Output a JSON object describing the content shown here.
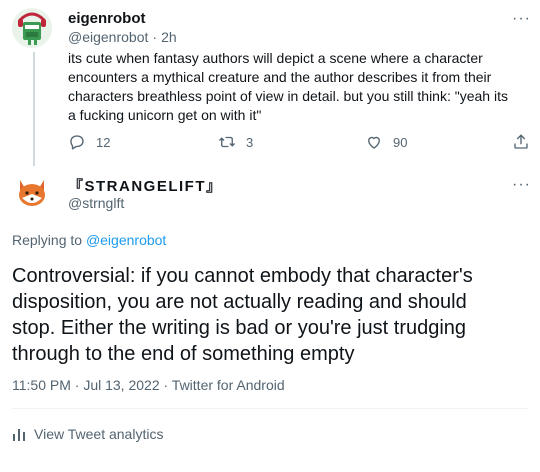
{
  "parent_tweet": {
    "author_name": "eigenrobot",
    "author_handle": "@eigenrobot",
    "separator": "·",
    "time": "2h",
    "text": "its cute when fantasy authors will depict a scene where a character encounters a mythical creature and the author describes it from their characters breathless point of view in detail. but you still think: \"yeah its a fucking unicorn get on with it\"",
    "replies": "12",
    "retweets": "3",
    "likes": "90",
    "more": "···"
  },
  "reply_tweet": {
    "author_name": "『STRANGELIFT』",
    "author_handle": "@strnglft",
    "more": "···",
    "replying_prefix": "Replying to",
    "replying_handle": "@eigenrobot",
    "text": "Controversial: if you cannot embody that character's disposition, you are not actually reading and should stop. Either the writing is bad or you're just trudging through to the end of something empty",
    "timestamp": "11:50 PM · Jul 13, 2022 · Twitter for Android",
    "analytics_label": "View Tweet analytics"
  },
  "colors": {
    "accent": "#1d9bf0",
    "muted": "#536471",
    "text": "#0f1419",
    "divider": "#eff3f4"
  },
  "icons": [
    "robot-avatar",
    "fox-avatar",
    "reply-icon",
    "retweet-icon",
    "like-icon",
    "share-icon",
    "analytics-icon",
    "more-icon"
  ]
}
